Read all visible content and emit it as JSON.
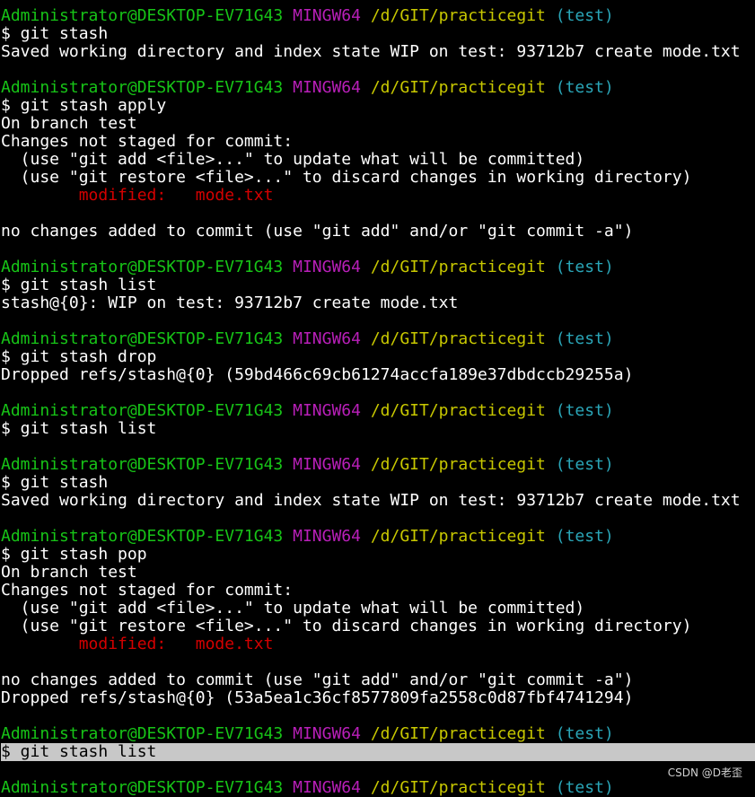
{
  "prompt": {
    "user": "Administrator@DESKTOP-EV71G43",
    "system": "MINGW64",
    "path": "/d/GIT/practicegit",
    "branch": "(test)"
  },
  "lines": {
    "l01": "$ git stash",
    "l02": "Saved working directory and index state WIP on test: 93712b7 create mode.txt",
    "l03": "$ git stash apply",
    "l04": "On branch test",
    "l05": "Changes not staged for commit:",
    "l06": "  (use \"git add <file>...\" to update what will be committed)",
    "l07": "  (use \"git restore <file>...\" to discard changes in working directory)",
    "l08_label": "        modified:   ",
    "l08_file": "mode.txt",
    "l09": "no changes added to commit (use \"git add\" and/or \"git commit -a\")",
    "l10": "$ git stash list",
    "l11": "stash@{0}: WIP on test: 93712b7 create mode.txt",
    "l12": "$ git stash drop",
    "l13": "Dropped refs/stash@{0} (59bd466c69cb61274accfa189e37dbdccb29255a)",
    "l14": "$ git stash list",
    "l15": "$ git stash",
    "l16": "Saved working directory and index state WIP on test: 93712b7 create mode.txt",
    "l17": "$ git stash pop",
    "l18": "On branch test",
    "l19": "Changes not staged for commit:",
    "l20": "  (use \"git add <file>...\" to update what will be committed)",
    "l21": "  (use \"git restore <file>...\" to discard changes in working directory)",
    "l22_label": "        modified:   ",
    "l22_file": "mode.txt",
    "l23": "no changes added to commit (use \"git add\" and/or \"git commit -a\")",
    "l24": "Dropped refs/stash@{0} (53a5ea1c36cf8577809fa2558c0d87fbf4741294)",
    "l25_plain": "$ git s",
    "l25_selected": "tash list"
  },
  "watermark": "CSDN @D老歪",
  "colors": {
    "background": "#000000",
    "text": "#ffffff",
    "user": "#17c417",
    "system": "#b91fb9",
    "path": "#c8c800",
    "branch": "#2aa6b8",
    "modified": "#d40000",
    "selection": "#c8c8c8"
  }
}
